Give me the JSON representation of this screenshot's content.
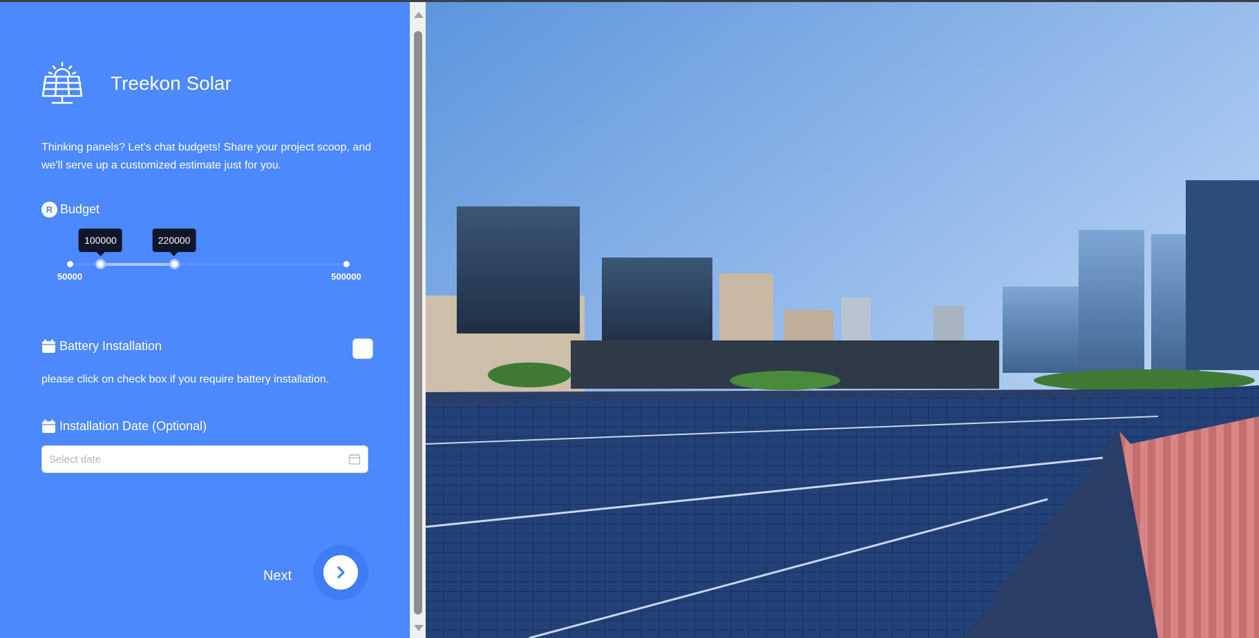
{
  "brand": {
    "name": "Treekon Solar"
  },
  "intro": "Thinking panels? Let's chat budgets! Share your project scoop, and we'll serve up a customized estimate just for you.",
  "budget": {
    "currency_symbol": "R",
    "label": "Budget",
    "min": 50000,
    "max": 500000,
    "low": 100000,
    "high": 220000,
    "min_label": "50000",
    "max_label": "500000",
    "low_label": "100000",
    "high_label": "220000"
  },
  "battery": {
    "label": "Battery Installation",
    "checked": false,
    "hint": "please click on check box if you require battery installation."
  },
  "install_date": {
    "label": "Installation Date (Optional)",
    "placeholder": "Select date",
    "value": ""
  },
  "next": {
    "label": "Next"
  },
  "colors": {
    "panel": "#4c88fe",
    "tooltip": "#10162a",
    "next_button": "#3f7df7"
  },
  "hero_image": {
    "icon": "city-solar-rooftop-photo"
  }
}
